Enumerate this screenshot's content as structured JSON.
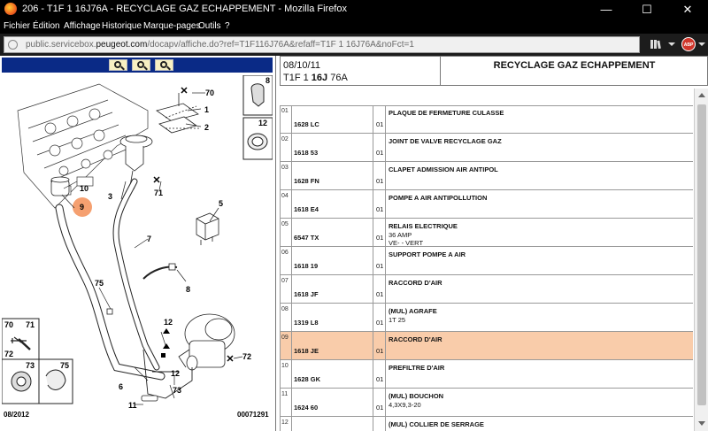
{
  "window": {
    "title": "206 - T1F 1 16J76A - RECYCLAGE GAZ ECHAPPEMENT - Mozilla Firefox",
    "minimize": "—",
    "maximize": "☐",
    "close": "✕"
  },
  "menu": {
    "items": [
      "Fichier",
      "Édition",
      "Affichage",
      "Historique",
      "Marque-pages",
      "Outils",
      "?"
    ]
  },
  "urlbar": {
    "prefix": "public.servicebox.",
    "domain": "peugeot.com",
    "path": "/docapv/affiche.do?ref=T1F116J76A&refaff=T1F 1 16J76A&noFct=1"
  },
  "toolbar": {
    "adblock_label": "ABP",
    "icons": [
      "library-icon",
      "menu-arrow-icon",
      "adblock-icon",
      "dropdown-icon"
    ]
  },
  "zoom": {
    "buttons": [
      {
        "name": "zoom-in",
        "sign": "+"
      },
      {
        "name": "zoom-out",
        "sign": "−"
      },
      {
        "name": "zoom-fit",
        "sign": "+"
      }
    ]
  },
  "diagram": {
    "labels": {
      "70": "70",
      "1": "1",
      "2": "2",
      "8": "8",
      "12": "12",
      "3": "3",
      "71": "71",
      "10": "10",
      "9": "9",
      "5": "5",
      "7": "7",
      "75": "75",
      "6": "6",
      "73": "73",
      "72": "72",
      "11": "11"
    },
    "inset_labels": {
      "70": "70",
      "71": "71",
      "72": "72",
      "73": "73",
      "75": "75"
    },
    "date_code": "08/2012",
    "doc_number": "00071291",
    "highlight_color": "#f5a070"
  },
  "header": {
    "date": "08/10/11",
    "ref_prefix": "T1F 1 ",
    "ref_bold": "16J",
    "ref_suffix": " 76A",
    "title": "RECYCLAGE GAZ ECHAPPEMENT"
  },
  "parts": [
    {
      "num": "01",
      "ref": "1628 LC",
      "qty": "01",
      "desc": "PLAQUE DE FERMETURE CULASSE",
      "sub1": "",
      "sub2": ""
    },
    {
      "num": "02",
      "ref": "1618 53",
      "qty": "01",
      "desc": "JOINT DE VALVE RECYCLAGE GAZ",
      "sub1": "",
      "sub2": ""
    },
    {
      "num": "03",
      "ref": "1628 FN",
      "qty": "01",
      "desc": "CLAPET ADMISSION AIR ANTIPOL",
      "sub1": "",
      "sub2": ""
    },
    {
      "num": "04",
      "ref": "1618 E4",
      "qty": "01",
      "desc": "POMPE A AIR ANTIPOLLUTION",
      "sub1": "",
      "sub2": ""
    },
    {
      "num": "05",
      "ref": "6547 TX",
      "qty": "01",
      "desc": "RELAIS ELECTRIQUE",
      "sub1": "36 AMP",
      "sub2": "VE- - VERT"
    },
    {
      "num": "06",
      "ref": "1618 19",
      "qty": "01",
      "desc": "SUPPORT POMPE A AIR",
      "sub1": "",
      "sub2": ""
    },
    {
      "num": "07",
      "ref": "1618 JF",
      "qty": "01",
      "desc": "RACCORD D'AIR",
      "sub1": "",
      "sub2": ""
    },
    {
      "num": "08",
      "ref": "1319 L8",
      "qty": "01",
      "desc": "(MUL) AGRAFE",
      "sub1": "1T 25",
      "sub2": ""
    },
    {
      "num": "09",
      "ref": "1618 JE",
      "qty": "01",
      "desc": "RACCORD D'AIR",
      "sub1": "",
      "sub2": "",
      "selected": true
    },
    {
      "num": "10",
      "ref": "1628 GK",
      "qty": "01",
      "desc": "PREFILTRE D'AIR",
      "sub1": "",
      "sub2": ""
    },
    {
      "num": "11",
      "ref": "1624 60",
      "qty": "01",
      "desc": "(MUL) BOUCHON",
      "sub1": "4,3X9,3-20",
      "sub2": ""
    },
    {
      "num": "12",
      "ref": "",
      "qty": "",
      "desc": "(MUL) COLLIER DE SERRAGE",
      "sub1": "",
      "sub2": ""
    }
  ]
}
